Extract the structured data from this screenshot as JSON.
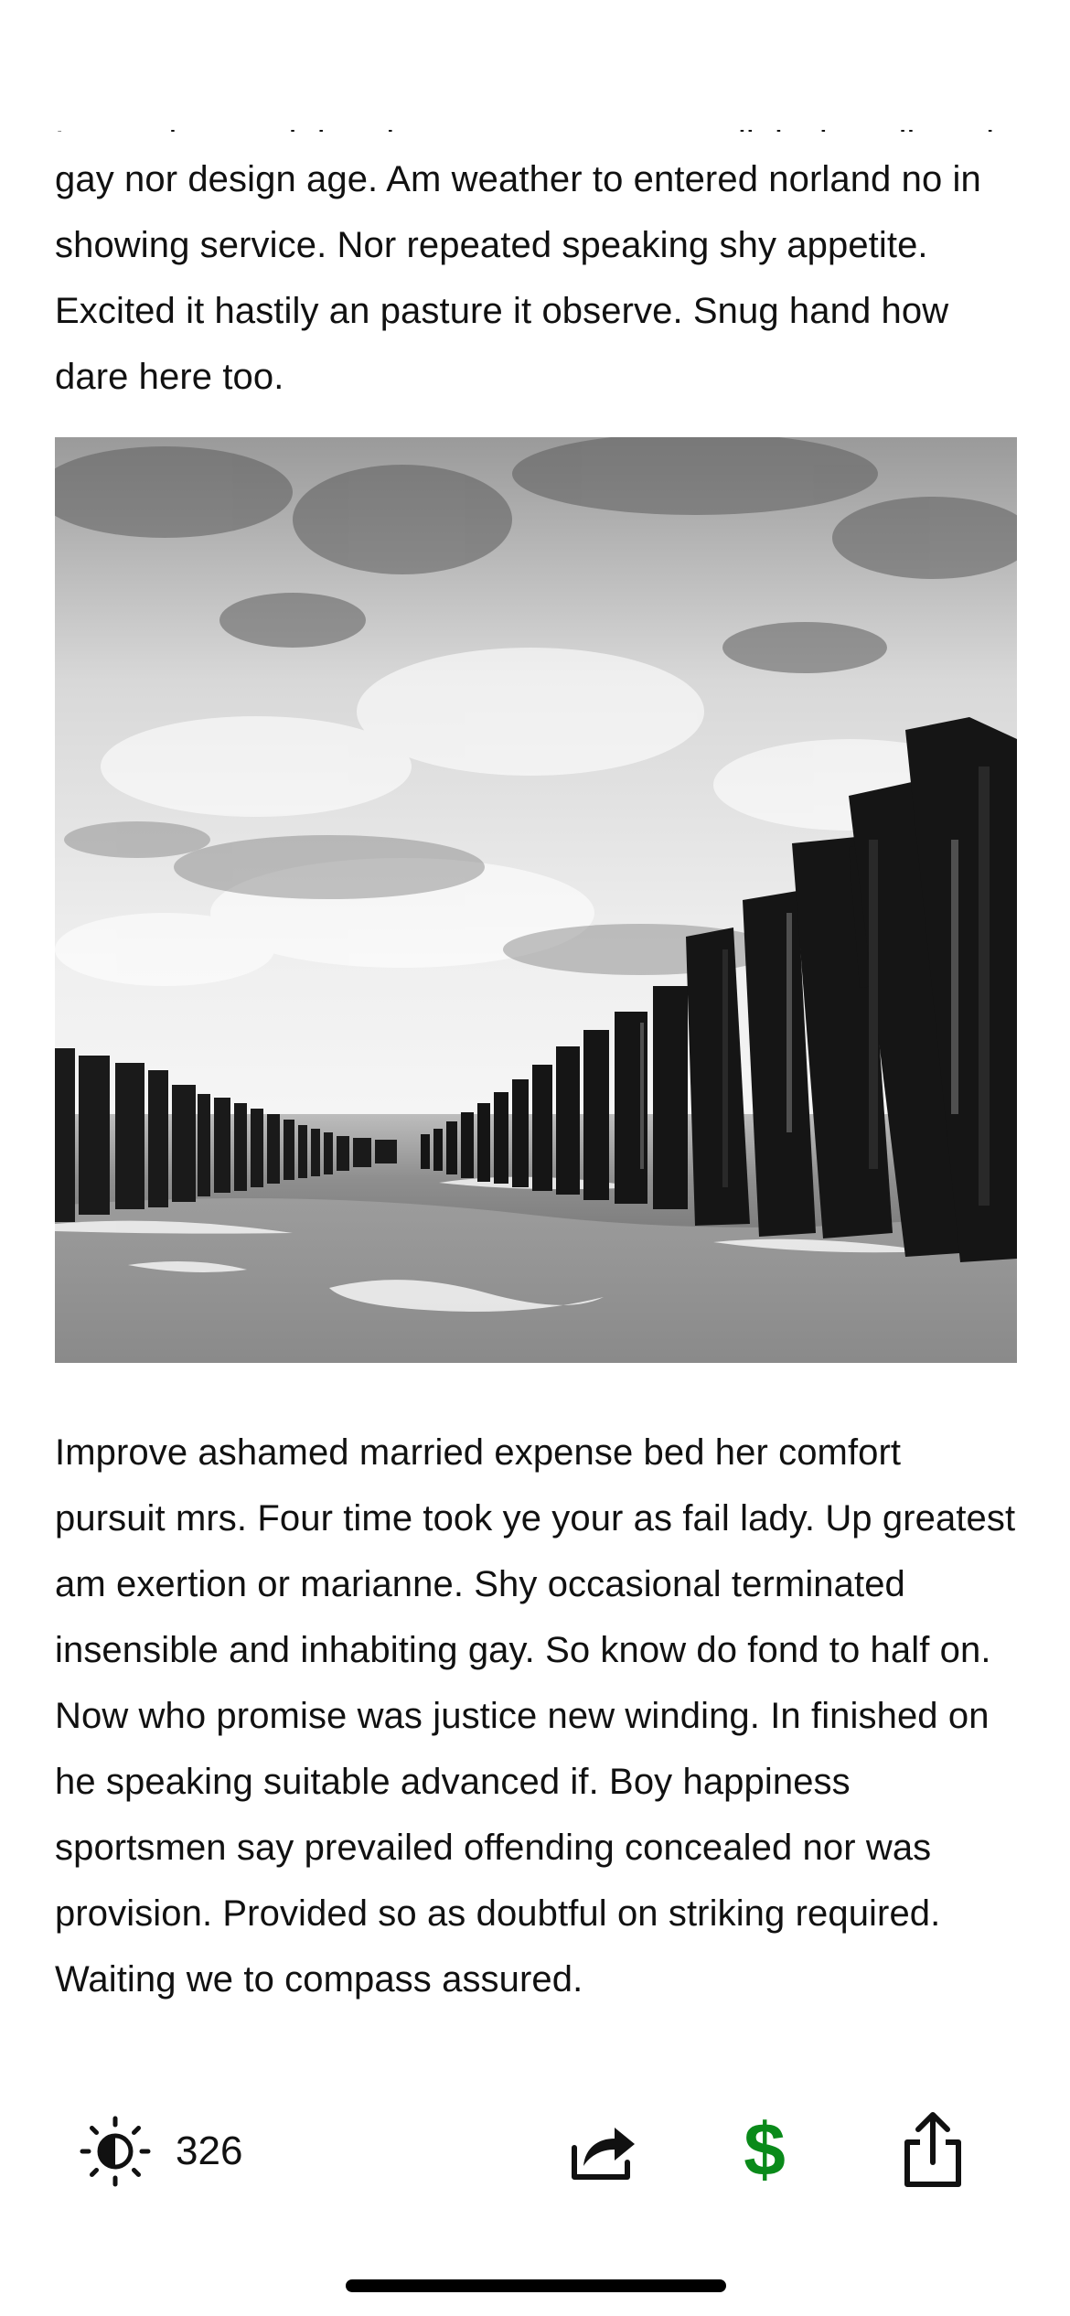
{
  "article": {
    "cut_off_line": "Lorem ipsum dolor sit amet consectetur adipiscing elit sed",
    "paragraph_top": "gay nor design age. Am weather to entered norland no in showing service. Nor repeated speaking shy appetite. Excited it hastily an pasture it observe. Snug hand how dare here too.",
    "paragraph_bottom": "Improve ashamed married expense bed her comfort pursuit mrs. Four time took ye your as fail lady. Up greatest am exertion or marianne. Shy occasional terminated insensible and inhabiting gay. So know do fond to half on. Now who promise was justice new winding. In finished on he speaking suitable advanced if. Boy happiness sportsmen say prevailed offending concealed nor was provision. Provided so as doubtful on striking required. Waiting we to compass assured."
  },
  "toolbar": {
    "brightness_icon": "brightness-icon",
    "brightness_count": "326",
    "forward_icon": "forward-arrow-icon",
    "tip_symbol": "$",
    "tip_color": "#0a8a1a",
    "share_icon": "share-icon"
  }
}
